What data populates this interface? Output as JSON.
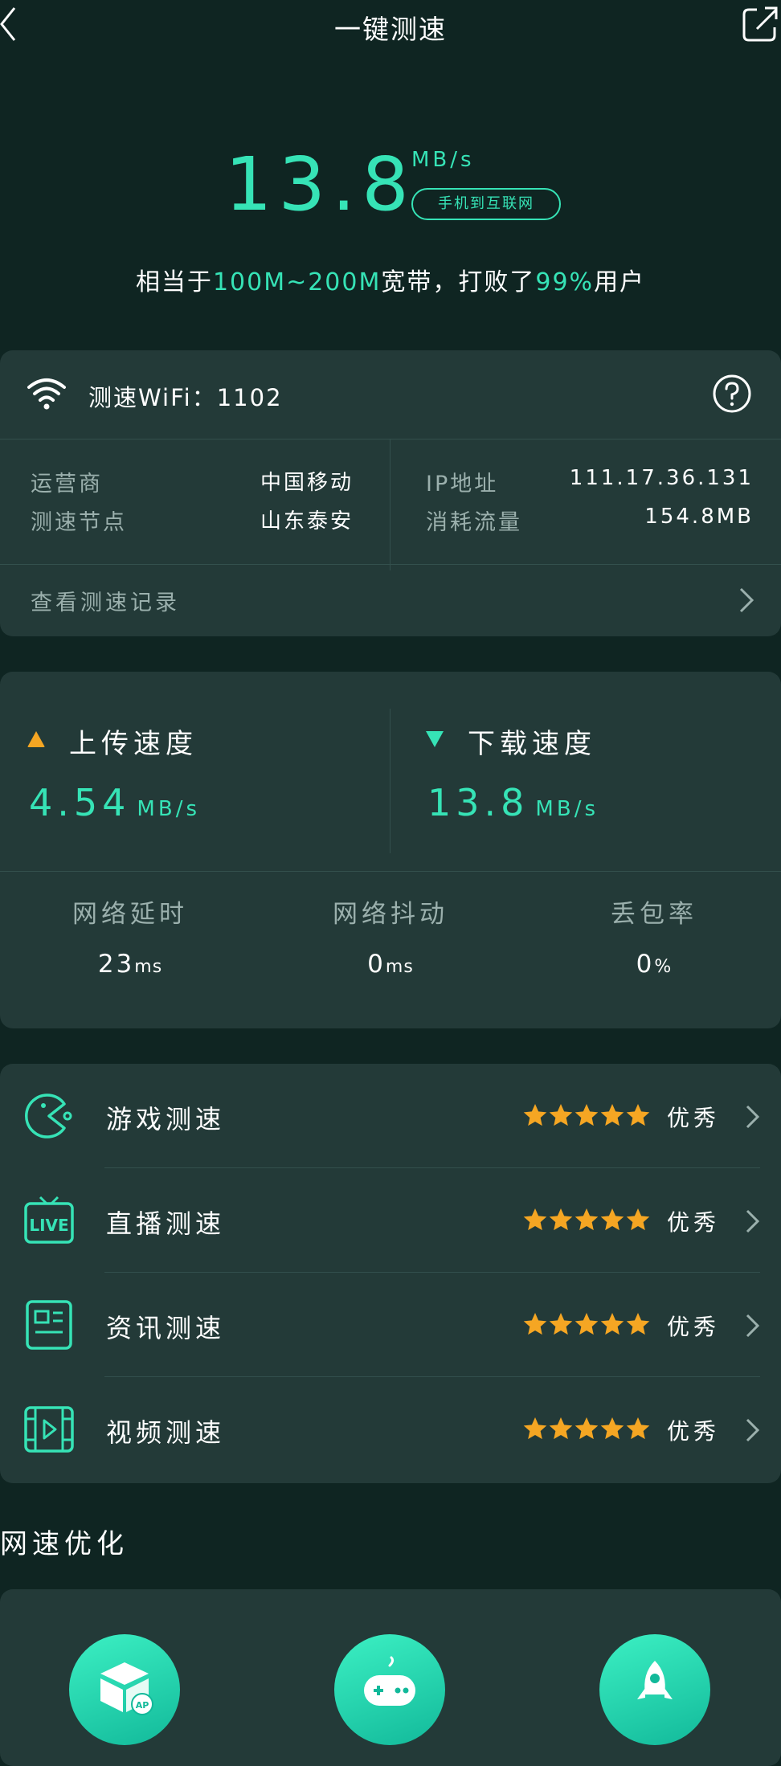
{
  "header": {
    "title": "一键测速",
    "back_icon": "chevron-left-icon",
    "share_icon": "external-share-icon"
  },
  "hero": {
    "speed": "13.8",
    "unit": "MB/s",
    "scope": "手机到互联网",
    "desc_prefix": "相当于",
    "desc_bandwidth": "100M~200M",
    "desc_mid": "宽带，打败了",
    "desc_percent": "99%",
    "desc_suffix": "用户"
  },
  "wifi_card": {
    "wifi_label": "测速WiFi：",
    "wifi_name": "1102",
    "info": {
      "carrier_label": "运营商",
      "carrier_value": "中国移动",
      "node_label": "测速节点",
      "node_value": "山东泰安",
      "ip_label": "IP地址",
      "ip_value": "111.17.36.131",
      "traffic_label": "消耗流量",
      "traffic_value": "154.8MB"
    },
    "record_label": "查看测速记录"
  },
  "speed_card": {
    "upload_label": "上传速度",
    "upload_value": "4.54",
    "upload_unit": "MB/s",
    "download_label": "下载速度",
    "download_value": "13.8",
    "download_unit": "MB/s",
    "stats": [
      {
        "label": "网络延时",
        "value": "23",
        "unit": "ms"
      },
      {
        "label": "网络抖动",
        "value": "0",
        "unit": "ms"
      },
      {
        "label": "丢包率",
        "value": "0",
        "unit": "%"
      }
    ]
  },
  "tests": [
    {
      "name": "游戏测速",
      "rating": 5,
      "grade": "优秀",
      "icon": "pacman-game-icon"
    },
    {
      "name": "直播测速",
      "rating": 5,
      "grade": "优秀",
      "icon": "live-tv-icon"
    },
    {
      "name": "资讯测速",
      "rating": 5,
      "grade": "优秀",
      "icon": "news-icon"
    },
    {
      "name": "视频测速",
      "rating": 5,
      "grade": "优秀",
      "icon": "video-film-icon"
    }
  ],
  "optimize": {
    "title": "网速优化",
    "items": [
      {
        "icon": "ap-box-icon"
      },
      {
        "icon": "gamepad-icon"
      },
      {
        "icon": "rocket-icon"
      }
    ]
  },
  "colors": {
    "accent": "#36e3b6",
    "upload": "#f5a623",
    "star": "#f5a623",
    "background": "#0f2522",
    "card": "#233a38"
  }
}
